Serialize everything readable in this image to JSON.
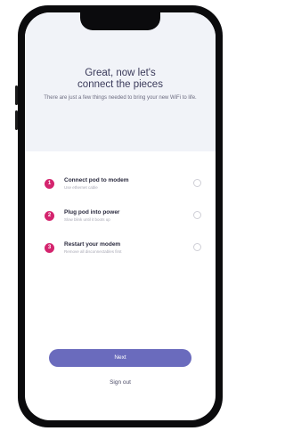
{
  "header": {
    "title_line1": "Great, now let's",
    "title_line2": "connect the pieces",
    "subtitle": "There are just a few things needed to bring your new WiFi to life."
  },
  "steps": [
    {
      "number": "1",
      "title": "Connect pod to modem",
      "description": "Use ethernet cable"
    },
    {
      "number": "2",
      "title": "Plug pod into power",
      "description": "Slow blink until it boots up"
    },
    {
      "number": "3",
      "title": "Restart your modem",
      "description": "Remove all disconnectables first"
    }
  ],
  "actions": {
    "next_label": "Next",
    "signout_label": "Sign out"
  },
  "colors": {
    "accent": "#6a6bbd",
    "step_badge": "#d4246e",
    "header_bg": "#f1f3f8"
  }
}
